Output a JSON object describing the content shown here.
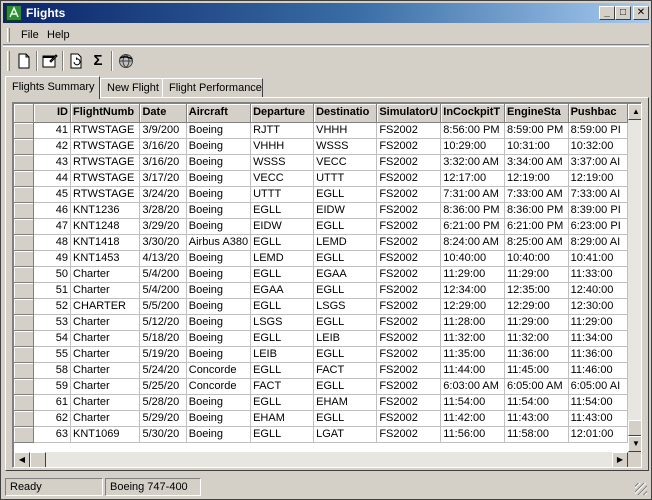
{
  "window": {
    "title": "Flights"
  },
  "titlebar_buttons": {
    "minimize": "_",
    "maximize": "□",
    "close": "✕"
  },
  "menu": {
    "items": [
      "File",
      "Help"
    ]
  },
  "toolbar": {
    "items": [
      "new-document-icon",
      "properties-icon",
      "refresh-icon",
      "sigma-icon",
      "globe-icon"
    ],
    "sigma_label": "Σ"
  },
  "tabs": [
    {
      "label": "Flights Summary",
      "active": true
    },
    {
      "label": "New Flight",
      "active": false
    },
    {
      "label": "Flight Performance",
      "active": false
    }
  ],
  "grid": {
    "columns": [
      "ID",
      "FlightNumb",
      "Date",
      "Aircraft",
      "Departure",
      "Destinatio",
      "SimulatorU",
      "InCockpitT",
      "EngineSta",
      "Pushbac"
    ],
    "rows": [
      [
        "41",
        "RTWSTAGE",
        "3/9/200",
        "Boeing",
        "RJTT",
        "VHHH",
        "FS2002",
        "8:56:00 PM",
        "8:59:00 PM",
        "8:59:00 PI"
      ],
      [
        "42",
        "RTWSTAGE",
        "3/16/20",
        "Boeing",
        "VHHH",
        "WSSS",
        "FS2002",
        "10:29:00",
        "10:31:00",
        "10:32:00"
      ],
      [
        "43",
        "RTWSTAGE",
        "3/16/20",
        "Boeing",
        "WSSS",
        "VECC",
        "FS2002",
        "3:32:00 AM",
        "3:34:00 AM",
        "3:37:00 AI"
      ],
      [
        "44",
        "RTWSTAGE",
        "3/17/20",
        "Boeing",
        "VECC",
        "UTTT",
        "FS2002",
        "12:17:00",
        "12:19:00",
        "12:19:00"
      ],
      [
        "45",
        "RTWSTAGE",
        "3/24/20",
        "Boeing",
        "UTTT",
        "EGLL",
        "FS2002",
        "7:31:00 AM",
        "7:33:00 AM",
        "7:33:00 AI"
      ],
      [
        "46",
        "KNT1236",
        "3/28/20",
        "Boeing",
        "EGLL",
        "EIDW",
        "FS2002",
        "8:36:00 PM",
        "8:36:00 PM",
        "8:39:00 PI"
      ],
      [
        "47",
        "KNT1248",
        "3/29/20",
        "Boeing",
        "EIDW",
        "EGLL",
        "FS2002",
        "6:21:00 PM",
        "6:21:00 PM",
        "6:23:00 PI"
      ],
      [
        "48",
        "KNT1418",
        "3/30/20",
        "Airbus A380",
        "EGLL",
        "LEMD",
        "FS2002",
        "8:24:00 AM",
        "8:25:00 AM",
        "8:29:00 AI"
      ],
      [
        "49",
        "KNT1453",
        "4/13/20",
        "Boeing",
        "LEMD",
        "EGLL",
        "FS2002",
        "10:40:00",
        "10:40:00",
        "10:41:00"
      ],
      [
        "50",
        "Charter",
        "5/4/200",
        "Boeing",
        "EGLL",
        "EGAA",
        "FS2002",
        "11:29:00",
        "11:29:00",
        "11:33:00"
      ],
      [
        "51",
        "Charter",
        "5/4/200",
        "Boeing",
        "EGAA",
        "EGLL",
        "FS2002",
        "12:34:00",
        "12:35:00",
        "12:40:00"
      ],
      [
        "52",
        "CHARTER",
        "5/5/200",
        "Boeing",
        "EGLL",
        "LSGS",
        "FS2002",
        "12:29:00",
        "12:29:00",
        "12:30:00"
      ],
      [
        "53",
        "Charter",
        "5/12/20",
        "Boeing",
        "LSGS",
        "EGLL",
        "FS2002",
        "11:28:00",
        "11:29:00",
        "11:29:00"
      ],
      [
        "54",
        "Charter",
        "5/18/20",
        "Boeing",
        "EGLL",
        "LEIB",
        "FS2002",
        "11:32:00",
        "11:32:00",
        "11:34:00"
      ],
      [
        "55",
        "Charter",
        "5/19/20",
        "Boeing",
        "LEIB",
        "EGLL",
        "FS2002",
        "11:35:00",
        "11:36:00",
        "11:36:00"
      ],
      [
        "58",
        "Charter",
        "5/24/20",
        "Concorde",
        "EGLL",
        "FACT",
        "FS2002",
        "11:44:00",
        "11:45:00",
        "11:46:00"
      ],
      [
        "59",
        "Charter",
        "5/25/20",
        "Concorde",
        "FACT",
        "EGLL",
        "FS2002",
        "6:03:00 AM",
        "6:05:00 AM",
        "6:05:00 AI"
      ],
      [
        "61",
        "Charter",
        "5/28/20",
        "Boeing",
        "EGLL",
        "EHAM",
        "FS2002",
        "11:54:00",
        "11:54:00",
        "11:54:00"
      ],
      [
        "62",
        "Charter",
        "5/29/20",
        "Boeing",
        "EHAM",
        "EGLL",
        "FS2002",
        "11:42:00",
        "11:43:00",
        "11:43:00"
      ],
      [
        "63",
        "KNT1069",
        "5/30/20",
        "Boeing",
        "EGLL",
        "LGAT",
        "FS2002",
        "11:56:00",
        "11:58:00",
        "12:01:00"
      ]
    ]
  },
  "scroll": {
    "up": "▲",
    "down": "▼",
    "left": "◀",
    "right": "▶"
  },
  "status": {
    "left": "Ready",
    "right": "Boeing 747-400"
  }
}
